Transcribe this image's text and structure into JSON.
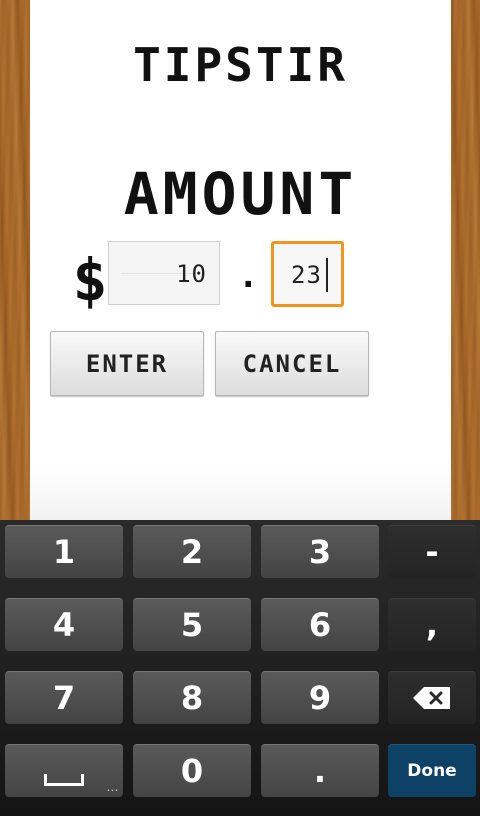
{
  "app": {
    "title": "TIPSTIR",
    "amount_label": "AMOUNT",
    "currency_symbol": "$",
    "decimal_point": "."
  },
  "amount": {
    "dollars": "10",
    "cents": "23"
  },
  "buttons": {
    "enter": "ENTER",
    "cancel": "CANCEL"
  },
  "colors": {
    "focus_accent": "#f0961e",
    "done_key": "#0d4166"
  },
  "keyboard": {
    "rows": [
      [
        "1",
        "2",
        "3",
        "-"
      ],
      [
        "4",
        "5",
        "6",
        ","
      ],
      [
        "7",
        "8",
        "9",
        "backspace-icon"
      ],
      [
        "space-icon",
        "0",
        ".",
        "Done"
      ]
    ],
    "done_label": "Done",
    "space_hint": "..."
  }
}
